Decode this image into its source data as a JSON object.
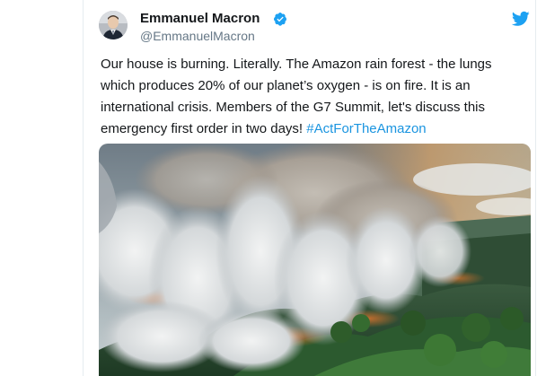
{
  "tweet": {
    "author": {
      "display_name": "Emmanuel Macron",
      "handle": "@EmmanuelMacron",
      "verified_icon": "verified-badge-icon"
    },
    "text_lines": [
      "Our house is burning. Literally. The Amazon rain forest - the lungs",
      "which produces 20% of our planet’s oxygen - is on fire. It is an",
      "international crisis. Members of the G7 Summit, let's discuss this"
    ],
    "text_last_line_prefix": "emergency first order in two days! ",
    "hashtag": "#ActForTheAmazon",
    "media": {
      "icon": "aerial-photo-amazon-fire"
    }
  },
  "colors": {
    "text": "#14171a",
    "secondary": "#657786",
    "link": "#1b95e0",
    "brand": "#1da1f2"
  },
  "icons": {
    "brand": "twitter-bird-icon"
  }
}
